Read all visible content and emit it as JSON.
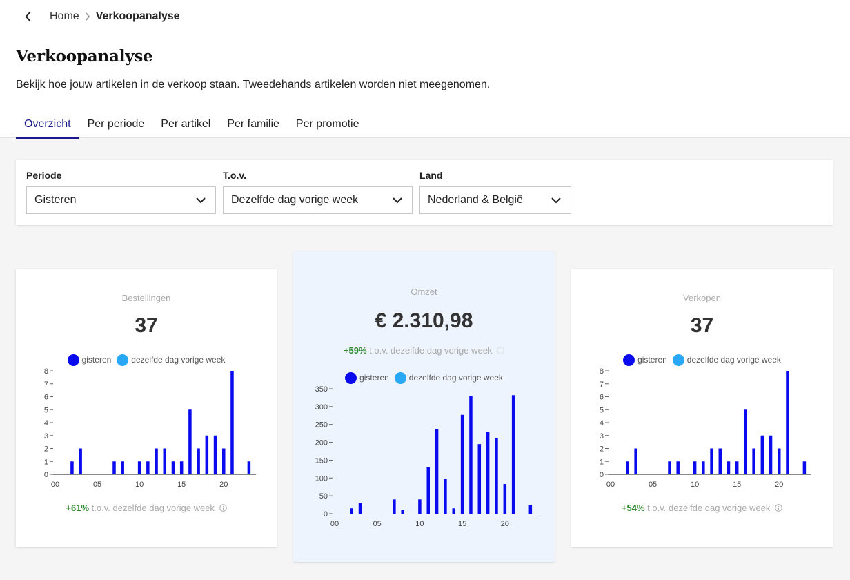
{
  "breadcrumb": {
    "home": "Home",
    "current": "Verkoopanalyse"
  },
  "page": {
    "title": "Verkoopanalyse",
    "subtitle": "Bekijk hoe jouw artikelen in de verkoop staan. Tweedehands artikelen worden niet meegenomen."
  },
  "tabs": [
    {
      "label": "Overzicht",
      "active": true
    },
    {
      "label": "Per periode"
    },
    {
      "label": "Per artikel"
    },
    {
      "label": "Per familie"
    },
    {
      "label": "Per promotie"
    }
  ],
  "filters": {
    "periode": {
      "label": "Periode",
      "value": "Gisteren"
    },
    "tov": {
      "label": "T.o.v.",
      "value": "Dezelfde dag vorige week"
    },
    "land": {
      "label": "Land",
      "value": "Nederland & België"
    }
  },
  "colors": {
    "primary_series": "#0a0aee",
    "compare_series": "#29a8f5",
    "positive": "#2e8b2e",
    "highlight_card": "#eef4fd"
  },
  "legend": {
    "primary": "gisteren",
    "compare": "dezelfde dag vorige week"
  },
  "cards": {
    "bestellingen": {
      "title": "Bestellingen",
      "value": "37",
      "delta_pct": "+61%",
      "delta_text": "t.o.v. dezelfde dag vorige week"
    },
    "omzet": {
      "title": "Omzet",
      "value": "€ 2.310,98",
      "delta_pct": "+59%",
      "delta_text": "t.o.v. dezelfde dag vorige week"
    },
    "verkopen": {
      "title": "Verkopen",
      "value": "37",
      "delta_pct": "+54%",
      "delta_text": "t.o.v. dezelfde dag vorige week"
    }
  },
  "chart_data": [
    {
      "type": "bar",
      "title": "Bestellingen",
      "x": [
        0,
        1,
        2,
        3,
        4,
        5,
        6,
        7,
        8,
        9,
        10,
        11,
        12,
        13,
        14,
        15,
        16,
        17,
        18,
        19,
        20,
        21,
        22,
        23
      ],
      "x_tick_labels": [
        "00",
        "05",
        "10",
        "15",
        "20"
      ],
      "x_tick_positions": [
        0,
        5,
        10,
        15,
        20
      ],
      "y_ticks": [
        0,
        1,
        2,
        3,
        4,
        5,
        6,
        7,
        8
      ],
      "ylim": [
        0,
        8
      ],
      "legend_position": "top-center",
      "grid": false,
      "series": [
        {
          "name": "gisteren",
          "values": [
            0,
            0,
            1,
            2,
            0,
            0,
            0,
            1,
            1,
            0,
            1,
            1,
            2,
            2,
            1,
            1,
            5,
            2,
            3,
            3,
            2,
            8,
            0,
            1
          ]
        },
        {
          "name": "dezelfde dag vorige week",
          "values": [
            0,
            0,
            0,
            0,
            0,
            0,
            0,
            0,
            0,
            0,
            0,
            0,
            0,
            0,
            0,
            0,
            0,
            0,
            0,
            0,
            0,
            0,
            0,
            0
          ]
        }
      ]
    },
    {
      "type": "bar",
      "title": "Omzet",
      "x": [
        0,
        1,
        2,
        3,
        4,
        5,
        6,
        7,
        8,
        9,
        10,
        11,
        12,
        13,
        14,
        15,
        16,
        17,
        18,
        19,
        20,
        21,
        22,
        23
      ],
      "x_tick_labels": [
        "00",
        "05",
        "10",
        "15",
        "20"
      ],
      "x_tick_positions": [
        0,
        5,
        10,
        15,
        20
      ],
      "y_ticks": [
        0,
        50,
        100,
        150,
        200,
        250,
        300,
        350
      ],
      "ylim": [
        0,
        350
      ],
      "legend_position": "top-center",
      "grid": false,
      "series": [
        {
          "name": "gisteren",
          "values": [
            0,
            0,
            15,
            30,
            0,
            0,
            0,
            40,
            10,
            0,
            40,
            130,
            237,
            97,
            15,
            277,
            330,
            195,
            230,
            212,
            83,
            332,
            0,
            25
          ]
        },
        {
          "name": "dezelfde dag vorige week",
          "values": [
            0,
            0,
            0,
            0,
            0,
            0,
            0,
            0,
            0,
            0,
            0,
            0,
            0,
            0,
            0,
            0,
            0,
            0,
            0,
            0,
            0,
            0,
            0,
            0
          ]
        }
      ]
    },
    {
      "type": "bar",
      "title": "Verkopen",
      "x": [
        0,
        1,
        2,
        3,
        4,
        5,
        6,
        7,
        8,
        9,
        10,
        11,
        12,
        13,
        14,
        15,
        16,
        17,
        18,
        19,
        20,
        21,
        22,
        23
      ],
      "x_tick_labels": [
        "00",
        "05",
        "10",
        "15",
        "20"
      ],
      "x_tick_positions": [
        0,
        5,
        10,
        15,
        20
      ],
      "y_ticks": [
        0,
        1,
        2,
        3,
        4,
        5,
        6,
        7,
        8
      ],
      "ylim": [
        0,
        8
      ],
      "legend_position": "top-center",
      "grid": false,
      "series": [
        {
          "name": "gisteren",
          "values": [
            0,
            0,
            1,
            2,
            0,
            0,
            0,
            1,
            1,
            0,
            1,
            1,
            2,
            2,
            1,
            1,
            5,
            2,
            3,
            3,
            2,
            8,
            0,
            1
          ]
        },
        {
          "name": "dezelfde dag vorige week",
          "values": [
            0,
            0,
            0,
            0,
            0,
            0,
            0,
            0,
            0,
            0,
            0,
            0,
            0,
            0,
            0,
            0,
            0,
            0,
            0,
            0,
            0,
            0,
            0,
            0
          ]
        }
      ]
    }
  ]
}
